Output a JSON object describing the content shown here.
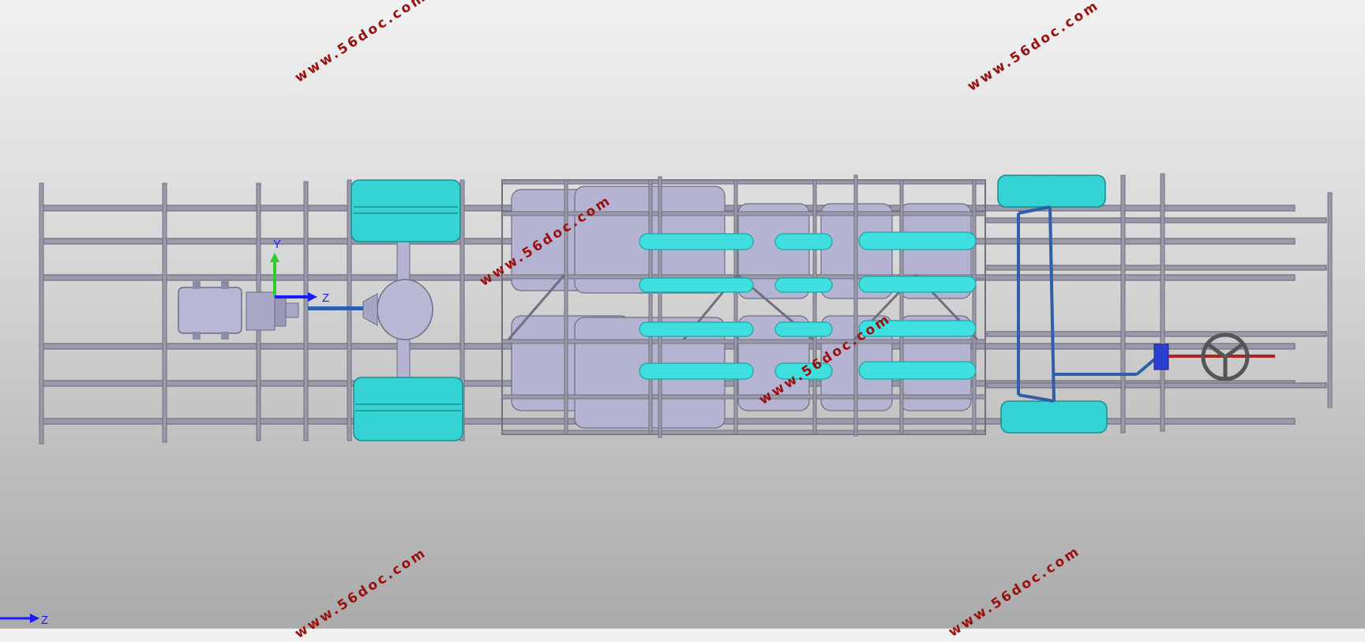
{
  "watermark": {
    "text": "www.56doc.com",
    "color": "#9b0f0f"
  },
  "part_triad": {
    "z_label": "Z",
    "y_label": "Y"
  },
  "view_triad": {
    "z_label": "Z"
  },
  "colors": {
    "frame": "#8a8a9a",
    "panel": "#b4b4d2",
    "wheel": "#35d3d3",
    "tank": "#3fdfdf",
    "steering": "#2f5fa8",
    "z_axis": "#1a1aff",
    "y_axis": "#2ecc2e",
    "drive_rod": "#b22222"
  }
}
